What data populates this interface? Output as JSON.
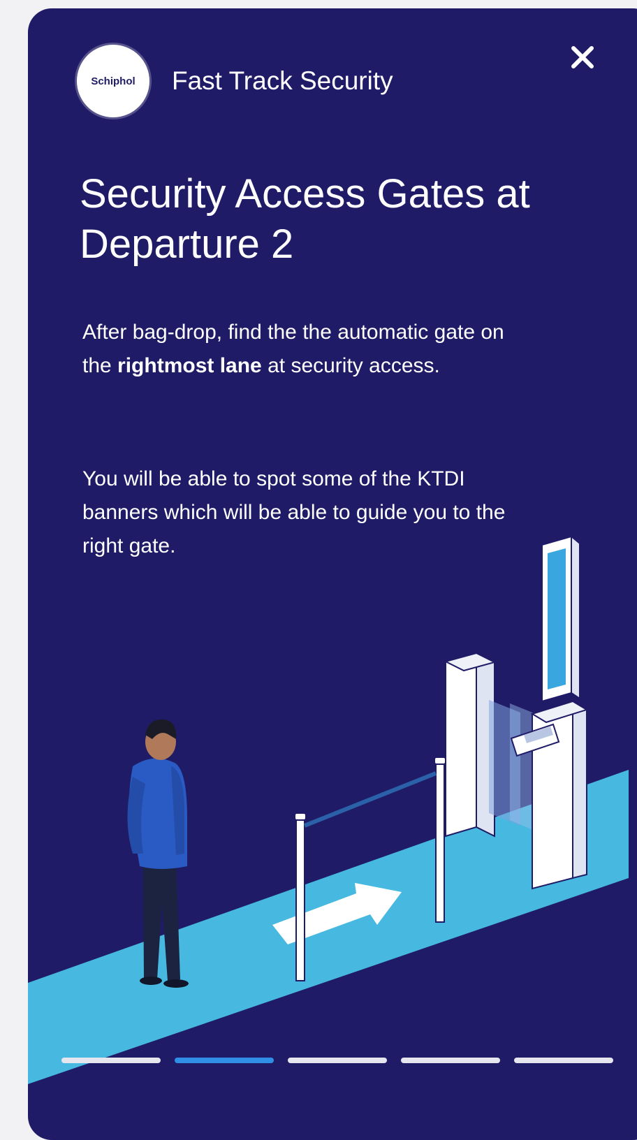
{
  "header": {
    "logo_text": "Schiphol",
    "title": "Fast Track Security",
    "close_icon": "close-icon"
  },
  "content": {
    "title": "Security Access Gates at Departure 2",
    "paragraph1": {
      "before": "After bag-drop, find the the automatic gate on the ",
      "bold": "rightmost lane",
      "after": " at security access."
    },
    "paragraph2": "You will be able to spot some of the KTDI banners which will be able to guide you to the right gate."
  },
  "pager": {
    "total": 5,
    "active_index": 1
  },
  "colors": {
    "background": "#1f1b66",
    "lane": "#47b8df",
    "active_dot": "#2f8fe6",
    "inactive_dot": "#e6e6ee"
  }
}
